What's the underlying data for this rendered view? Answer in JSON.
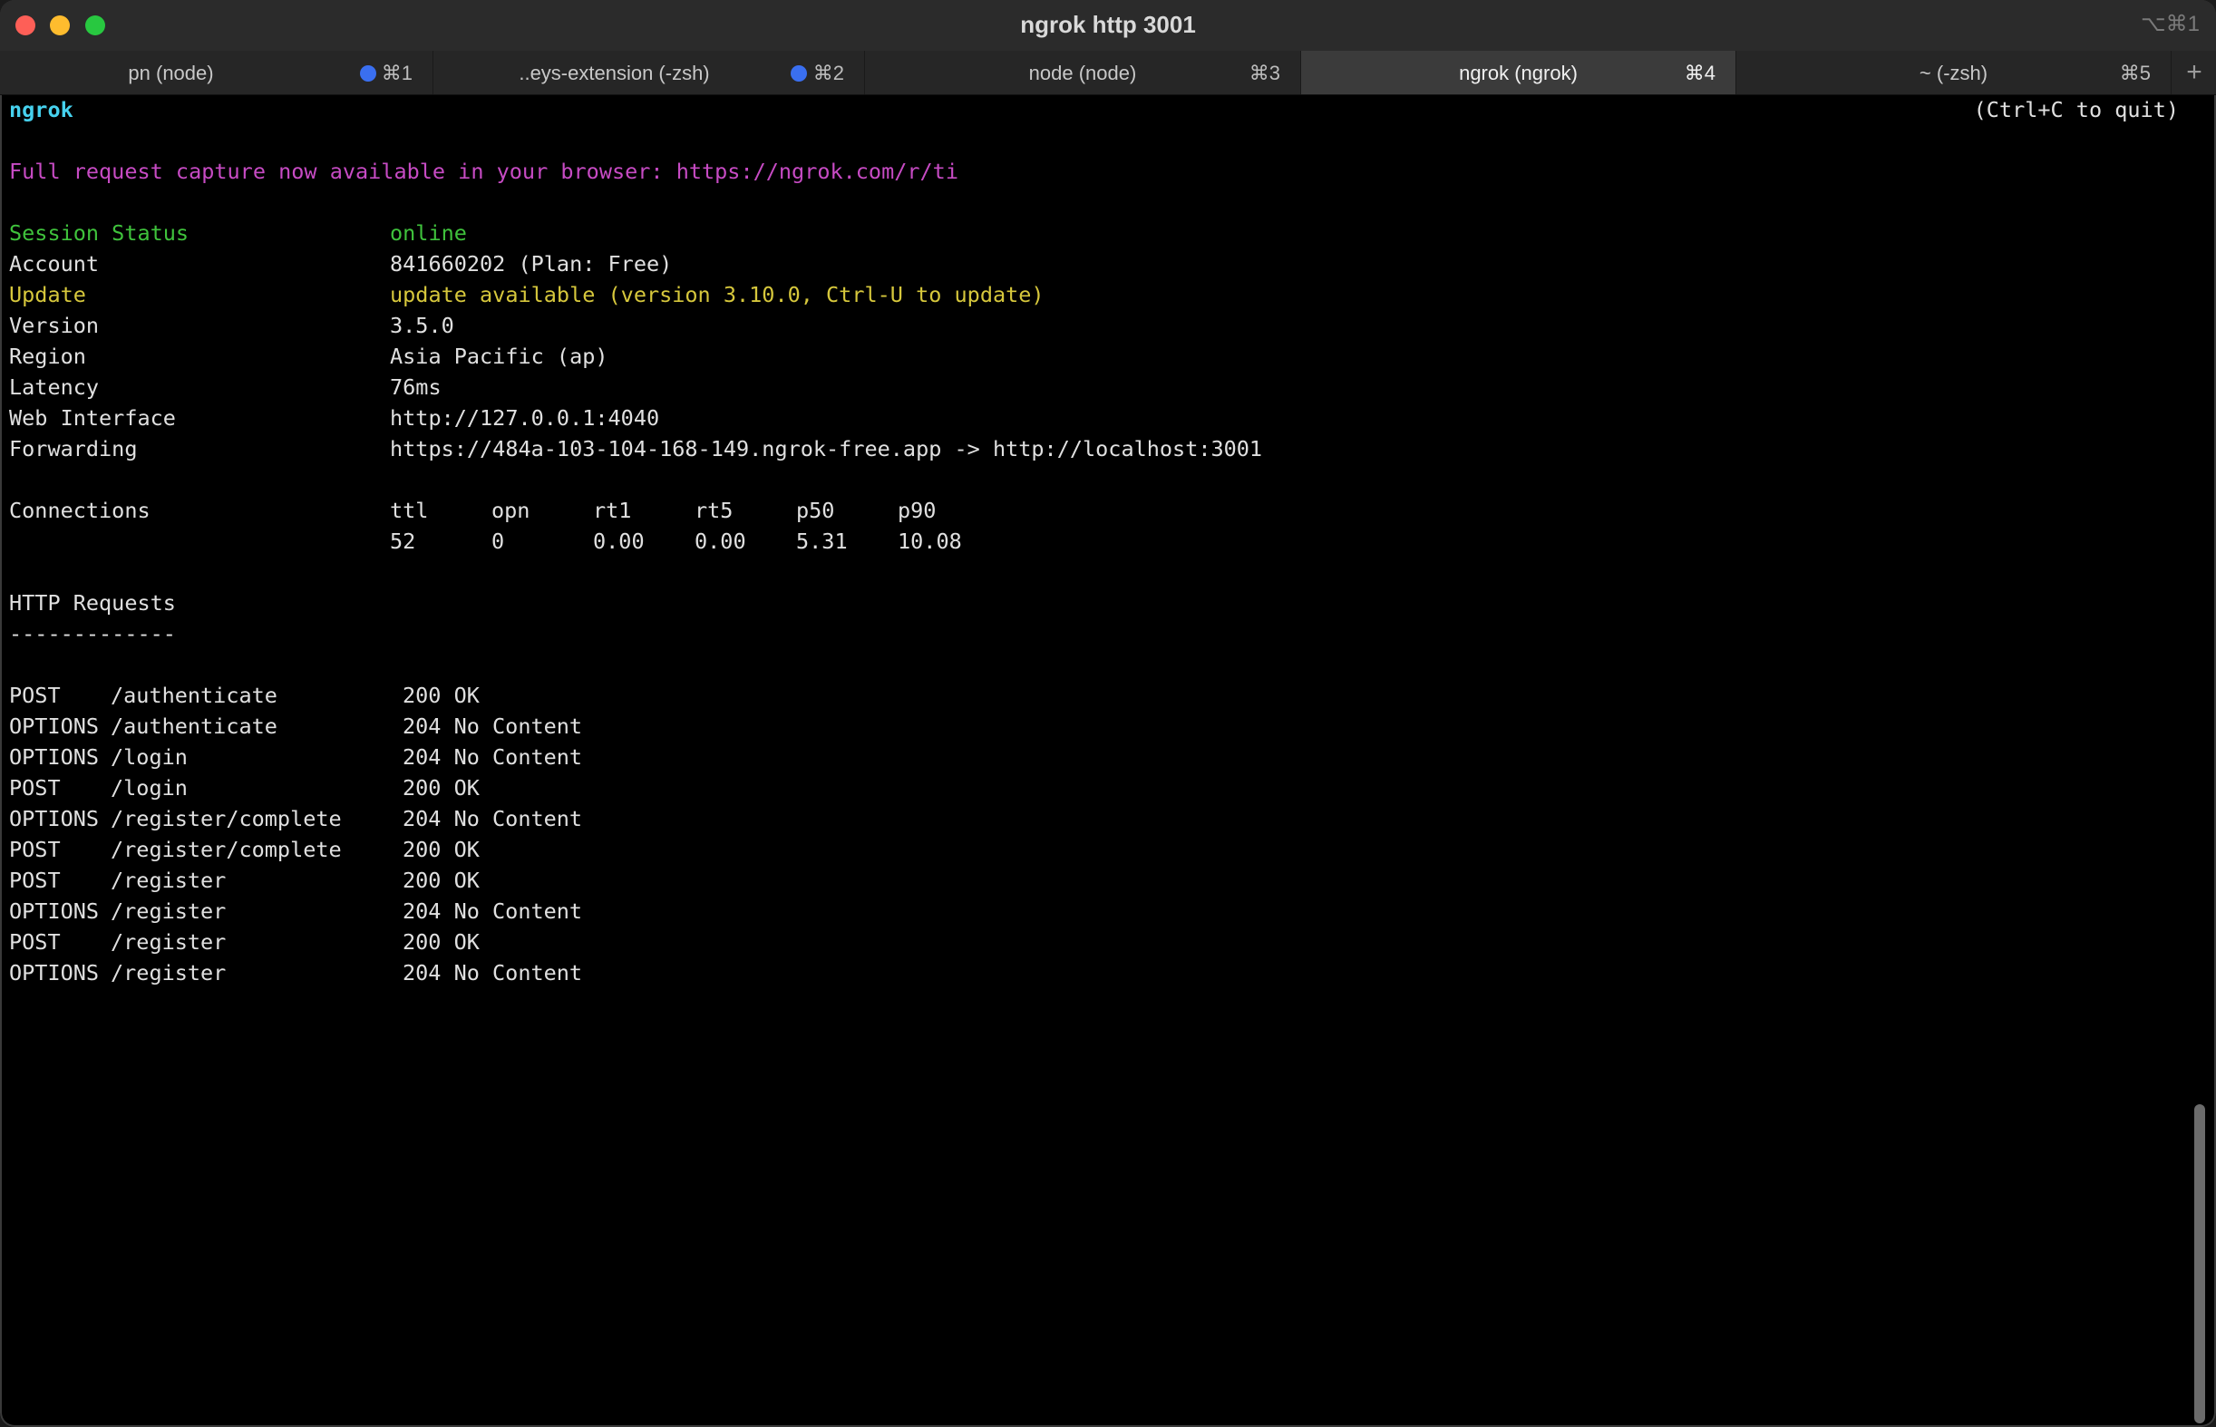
{
  "window": {
    "title": "ngrok http 3001",
    "shortcut": "⌥⌘1"
  },
  "tabs": [
    {
      "label": "pn (node)",
      "key": "⌘1",
      "dot": true,
      "active": false
    },
    {
      "label": "..eys-extension (-zsh)",
      "key": "⌘2",
      "dot": true,
      "active": false
    },
    {
      "label": "node (node)",
      "key": "⌘3",
      "dot": false,
      "active": false
    },
    {
      "label": "ngrok (ngrok)",
      "key": "⌘4",
      "dot": false,
      "active": true
    },
    {
      "label": "~ (-zsh)",
      "key": "⌘5",
      "dot": false,
      "active": false
    }
  ],
  "add_tab": "+",
  "terminal": {
    "app_name": "ngrok",
    "quit_hint": "(Ctrl+C to quit)",
    "capture_notice": "Full request capture now available in your browser: https://ngrok.com/r/ti",
    "status_rows": [
      {
        "key": "Session Status",
        "value": "online",
        "color": "green"
      },
      {
        "key": "Account",
        "value": "841660202 (Plan: Free)",
        "color": "default"
      },
      {
        "key": "Update",
        "value": "update available (version 3.10.0, Ctrl-U to update)",
        "color": "yellow"
      },
      {
        "key": "Version",
        "value": "3.5.0",
        "color": "default"
      },
      {
        "key": "Region",
        "value": "Asia Pacific (ap)",
        "color": "default"
      },
      {
        "key": "Latency",
        "value": "76ms",
        "color": "default"
      },
      {
        "key": "Web Interface",
        "value": "http://127.0.0.1:4040",
        "color": "default"
      },
      {
        "key": "Forwarding",
        "value": "https://484a-103-104-168-149.ngrok-free.app -> http://localhost:3001",
        "color": "default"
      }
    ],
    "connections": {
      "label": "Connections",
      "headers": [
        "ttl",
        "opn",
        "rt1",
        "rt5",
        "p50",
        "p90"
      ],
      "values": [
        "52",
        "0",
        "0.00",
        "0.00",
        "5.31",
        "10.08"
      ]
    },
    "http_requests": {
      "title": "HTTP Requests",
      "divider": "-------------",
      "rows": [
        {
          "method": "POST",
          "path": "/authenticate",
          "status": "200 OK"
        },
        {
          "method": "OPTIONS",
          "path": "/authenticate",
          "status": "204 No Content"
        },
        {
          "method": "OPTIONS",
          "path": "/login",
          "status": "204 No Content"
        },
        {
          "method": "POST",
          "path": "/login",
          "status": "200 OK"
        },
        {
          "method": "OPTIONS",
          "path": "/register/complete",
          "status": "204 No Content"
        },
        {
          "method": "POST",
          "path": "/register/complete",
          "status": "200 OK"
        },
        {
          "method": "POST",
          "path": "/register",
          "status": "200 OK"
        },
        {
          "method": "OPTIONS",
          "path": "/register",
          "status": "204 No Content"
        },
        {
          "method": "POST",
          "path": "/register",
          "status": "200 OK"
        },
        {
          "method": "OPTIONS",
          "path": "/register",
          "status": "204 No Content"
        }
      ]
    }
  },
  "colors": {
    "cyan": "#46d1ee",
    "magenta": "#c74bc4",
    "green": "#3fc23c",
    "yellow": "#d6c73c",
    "tab_dot": "#3a6ff0"
  }
}
